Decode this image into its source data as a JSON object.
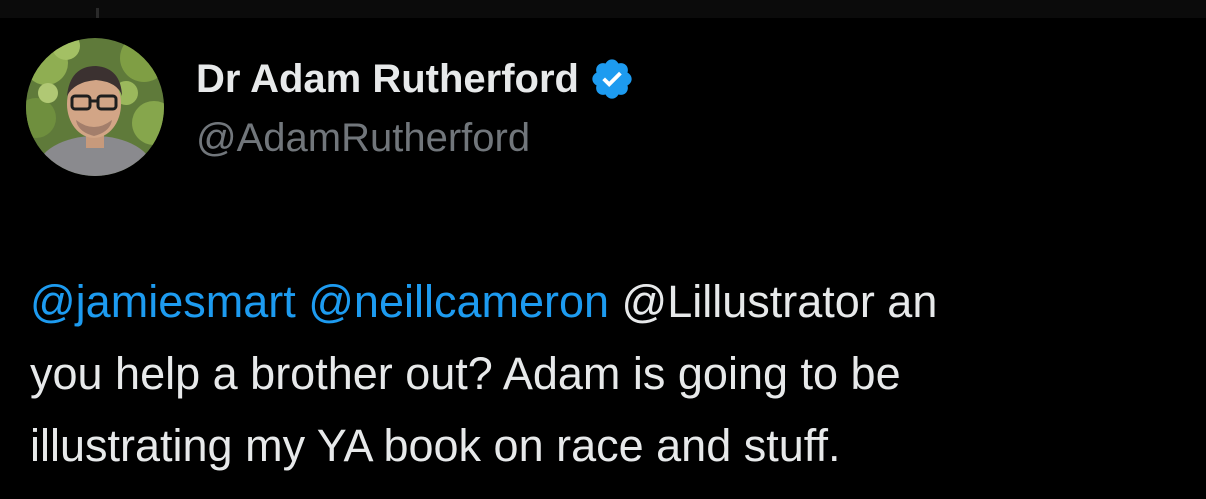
{
  "author": {
    "display_name": "Dr Adam Rutherford",
    "handle": "@AdamRutherford",
    "verified": true,
    "verified_icon": "verified-badge-icon",
    "verified_color": "#1d9bf0"
  },
  "tweet": {
    "mentions": [
      "@jamiesmart",
      "@neillcameron"
    ],
    "line1_rest": " @Lillustrator an",
    "line2": "you help a brother out? Adam is going to be",
    "line3": "illustrating my YA book on race and stuff."
  },
  "colors": {
    "background": "#000000",
    "text": "#e7e9ea",
    "secondary": "#71767b",
    "link": "#1d9bf0"
  }
}
